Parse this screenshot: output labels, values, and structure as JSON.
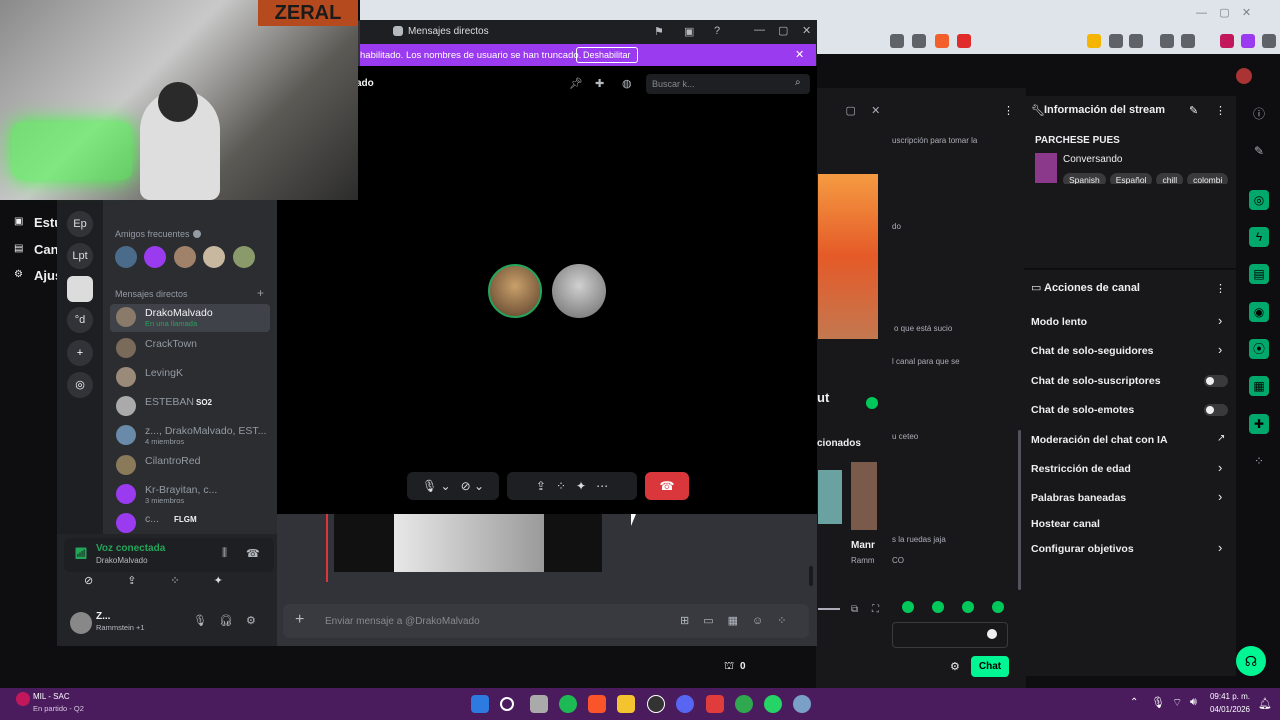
{
  "webcam": {
    "logo": "ZERAL"
  },
  "twitch_left": {
    "items": [
      "Estu",
      "Can",
      "Ajus"
    ]
  },
  "discord": {
    "title": "Mensajes directos",
    "banner_text": "habilitado. Los nombres de usuario se han truncado.",
    "banner_button": "Deshabilitar",
    "header_name": "ado",
    "search_placeholder": "Buscar k...",
    "guilds": [
      "Ep",
      "Lpt",
      "°d"
    ],
    "frequent_friends_label": "Amigos frecuentes",
    "dm_label": "Mensajes directos",
    "dms": [
      {
        "name": "DrakoMalvado",
        "sub": "En una llamada"
      },
      {
        "name": "CrackTown",
        "sub": ""
      },
      {
        "name": "LevingK",
        "sub": ""
      },
      {
        "name": "ESTEBAN",
        "sub": "",
        "badge": "SO2"
      },
      {
        "name": "z..., DrakoMalvado, EST...",
        "sub": "4 miembros"
      },
      {
        "name": "CilantroRed",
        "sub": ""
      },
      {
        "name": "Kr-Brayitan, c...",
        "sub": "3 miembros"
      },
      {
        "name": "c...",
        "sub": "",
        "badge": "FLGM"
      }
    ],
    "voice": {
      "status": "Voz conectada",
      "channel": "DrakoMalvado"
    },
    "user": {
      "name": "Z...",
      "activity": "Rammstein +1"
    },
    "chat_placeholder": "Enviar mensaje a @DrakoMalvado"
  },
  "twitch_mid": {
    "texts": [
      "uscripción para tomar la",
      "do",
      "o que está sucio",
      "l canal para que se",
      "ut",
      "cionados",
      "u ceteo",
      "s la ruedas jaja",
      "Manr",
      "Ramm",
      "CO"
    ],
    "bits_count": "0",
    "chat_button": "Chat"
  },
  "stream_info": {
    "title": "Información del stream",
    "stream_title": "PARCHESE PUES",
    "category": "Conversando",
    "tags": [
      "Spanish",
      "Español",
      "chill",
      "colombi"
    ]
  },
  "channel_actions": {
    "title": "Acciones de canal",
    "items": [
      {
        "label": "Modo lento",
        "kind": "chevron"
      },
      {
        "label": "Chat de solo-seguidores",
        "kind": "chevron"
      },
      {
        "label": "Chat de solo-suscriptores",
        "kind": "toggle"
      },
      {
        "label": "Chat de solo-emotes",
        "kind": "toggle"
      },
      {
        "label": "Moderación del chat con IA",
        "kind": "external"
      },
      {
        "label": "Restricción de edad",
        "kind": "chevron"
      },
      {
        "label": "Palabras baneadas",
        "kind": "chevron"
      },
      {
        "label": "Hostear canal",
        "kind": "none"
      },
      {
        "label": "Configurar objetivos",
        "kind": "chevron"
      }
    ]
  },
  "taskbar": {
    "weather_title": "MIL - SAC",
    "weather_sub": "En partido - Q2",
    "time": "09:41 p. m.",
    "date": "04/01/2026"
  },
  "colors": {
    "twitch_purple": "#9147ff",
    "discord_blurple": "#5865f2",
    "online_green": "#23a55a",
    "hangup_red": "#da373c",
    "chat_green": "#00f593"
  }
}
